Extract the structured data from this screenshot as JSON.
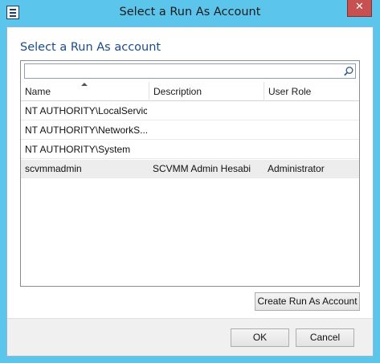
{
  "window": {
    "title": "Select a Run As Account"
  },
  "heading": "Select a Run As account",
  "search": {
    "value": "",
    "placeholder": ""
  },
  "columns": {
    "name": "Name",
    "description": "Description",
    "role": "User Role"
  },
  "rows": [
    {
      "name": "NT AUTHORITY\\LocalService",
      "description": "",
      "role": ""
    },
    {
      "name": "NT AUTHORITY\\NetworkS...",
      "description": "",
      "role": ""
    },
    {
      "name": "NT AUTHORITY\\System",
      "description": "",
      "role": ""
    },
    {
      "name": "scvmmadmin",
      "description": "SCVMM Admin Hesabi",
      "role": "Administrator"
    }
  ],
  "buttons": {
    "create": "Create Run As Account",
    "ok": "OK",
    "cancel": "Cancel"
  },
  "icons": {
    "app": "window-app-icon",
    "close": "close-icon",
    "search": "search-icon",
    "sort": "sort-ascending-icon"
  },
  "colors": {
    "titlebar": "#5cc5ec",
    "heading": "#1a4b8c",
    "close": "#c75050",
    "selected_row": "#ededed"
  }
}
